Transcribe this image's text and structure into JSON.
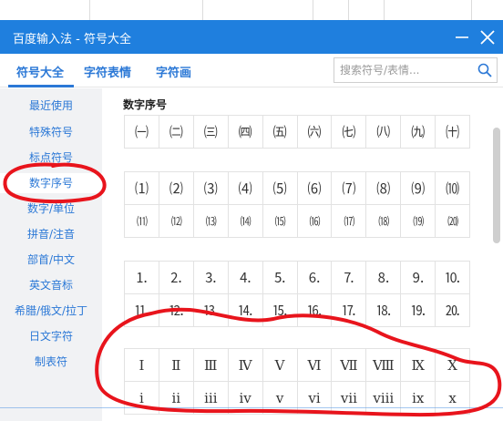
{
  "window": {
    "title": "百度输入法 - 符号大全"
  },
  "tabs": [
    {
      "label": "符号大全"
    },
    {
      "label": "字符表情"
    },
    {
      "label": "字符画"
    }
  ],
  "search": {
    "placeholder": "搜索符号/表情..."
  },
  "sidebar": {
    "items": [
      {
        "label": "最近使用"
      },
      {
        "label": "特殊符号"
      },
      {
        "label": "标点符号"
      },
      {
        "label": "数字序号"
      },
      {
        "label": "数字/单位"
      },
      {
        "label": "拼音/注音"
      },
      {
        "label": "部首/中文"
      },
      {
        "label": "英文音标"
      },
      {
        "label": "希腊/俄文/拉丁"
      },
      {
        "label": "日文字符"
      },
      {
        "label": "制表符"
      }
    ]
  },
  "main": {
    "section_title": "数字序号",
    "groups": [
      {
        "rows": [
          [
            "㈠",
            "㈡",
            "㈢",
            "㈣",
            "㈤",
            "㈥",
            "㈦",
            "㈧",
            "㈨",
            "㈩"
          ]
        ]
      },
      {
        "rows": [
          [
            "⑴",
            "⑵",
            "⑶",
            "⑷",
            "⑸",
            "⑹",
            "⑺",
            "⑻",
            "⑼",
            "⑽"
          ],
          [
            "⑾",
            "⑿",
            "⒀",
            "⒁",
            "⒂",
            "⒃",
            "⒄",
            "⒅",
            "⒆",
            "⒇"
          ]
        ]
      },
      {
        "rows": [
          [
            "⒈",
            "⒉",
            "⒊",
            "⒋",
            "⒌",
            "⒍",
            "⒎",
            "⒏",
            "⒐",
            "⒑"
          ],
          [
            "⒒",
            "⒓",
            "⒔",
            "⒕",
            "⒖",
            "⒗",
            "⒘",
            "⒙",
            "⒚",
            "⒛"
          ]
        ]
      },
      {
        "rows": [
          [
            "Ⅰ",
            "Ⅱ",
            "Ⅲ",
            "Ⅳ",
            "Ⅴ",
            "Ⅵ",
            "Ⅶ",
            "Ⅷ",
            "Ⅸ",
            "Ⅹ"
          ],
          [
            "ⅰ",
            "ⅱ",
            "ⅲ",
            "ⅳ",
            "ⅴ",
            "ⅵ",
            "ⅶ",
            "ⅷ",
            "ⅸ",
            "ⅹ"
          ]
        ]
      }
    ]
  },
  "icons": {
    "minimize": "minimize-icon",
    "close": "close-icon",
    "search": "search-icon"
  },
  "colors": {
    "titlebar": "#1f7fde",
    "accent": "#2b78d6",
    "sidebar_bg": "#f1f2f4",
    "annotation": "#e8141c"
  }
}
